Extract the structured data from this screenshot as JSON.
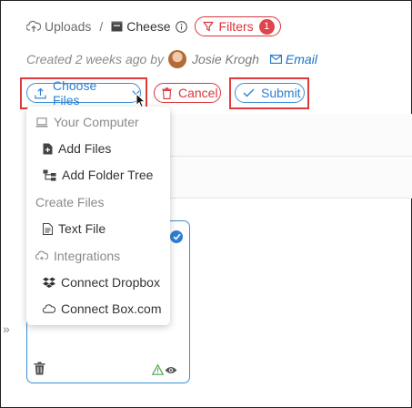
{
  "breadcrumb": {
    "root": "Uploads",
    "separator": "/",
    "folder": "Cheese"
  },
  "filters": {
    "label": "Filters",
    "count": "1"
  },
  "meta": {
    "created": "Created 2 weeks ago by",
    "author": "Josie Krogh",
    "email_label": "Email"
  },
  "actions": {
    "choose_files": "Choose Files",
    "cancel": "Cancel",
    "submit": "Submit"
  },
  "menu": {
    "section_computer": "Your Computer",
    "add_files": "Add Files",
    "add_folder_tree": "Add Folder Tree",
    "section_create": "Create Files",
    "text_file": "Text File",
    "section_integrations": "Integrations",
    "connect_dropbox": "Connect Dropbox",
    "connect_box": "Connect Box.com"
  },
  "colors": {
    "accent": "#2f7fd0",
    "danger": "#d9363e",
    "highlight_box": "#e03a3a"
  },
  "icons": [
    "cloud-upload-icon",
    "folder-icon",
    "info-icon",
    "filter-icon",
    "email-icon",
    "upload-icon",
    "chevron-down-icon",
    "trash-icon",
    "check-icon",
    "laptop-icon",
    "file-plus-icon",
    "folder-tree-icon",
    "text-file-icon",
    "integrations-icon",
    "dropbox-icon",
    "cloud-icon",
    "warning-icon",
    "eye-icon",
    "expand-icon"
  ]
}
